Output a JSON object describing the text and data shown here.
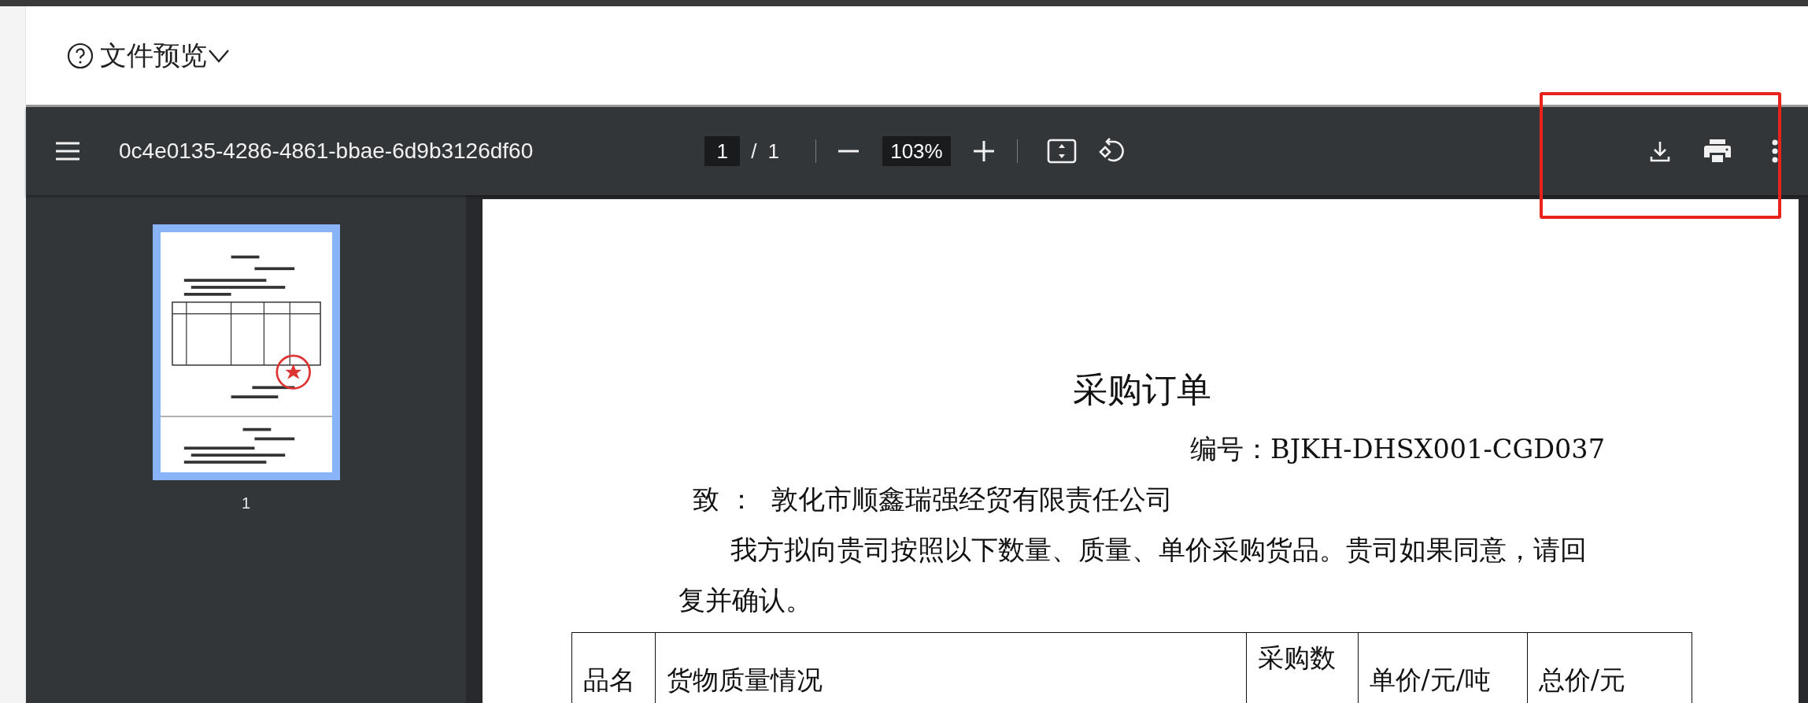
{
  "header": {
    "title": "文件预览"
  },
  "toolbar": {
    "filename": "0c4e0135-4286-4861-bbae-6d9b3126df60",
    "page_input": "1",
    "page_separator": "/",
    "page_count": "1",
    "zoom": "103%"
  },
  "sidebar": {
    "thumbnails": [
      {
        "label": "1",
        "selected": true
      }
    ]
  },
  "document": {
    "title": "采购订单",
    "number": "编号：BJKH-DHSX001-CGD037",
    "recipient": "致 ：  敦化市顺鑫瑞强经贸有限责任公司",
    "body": "我方拟向贵司按照以下数量、质量、单价采购货品。贵司如果同意，请回复并确认。",
    "table": {
      "columns": [
        "品名",
        "货物质量情况",
        "采购数",
        "单价/元/吨",
        "总价/元"
      ]
    }
  }
}
